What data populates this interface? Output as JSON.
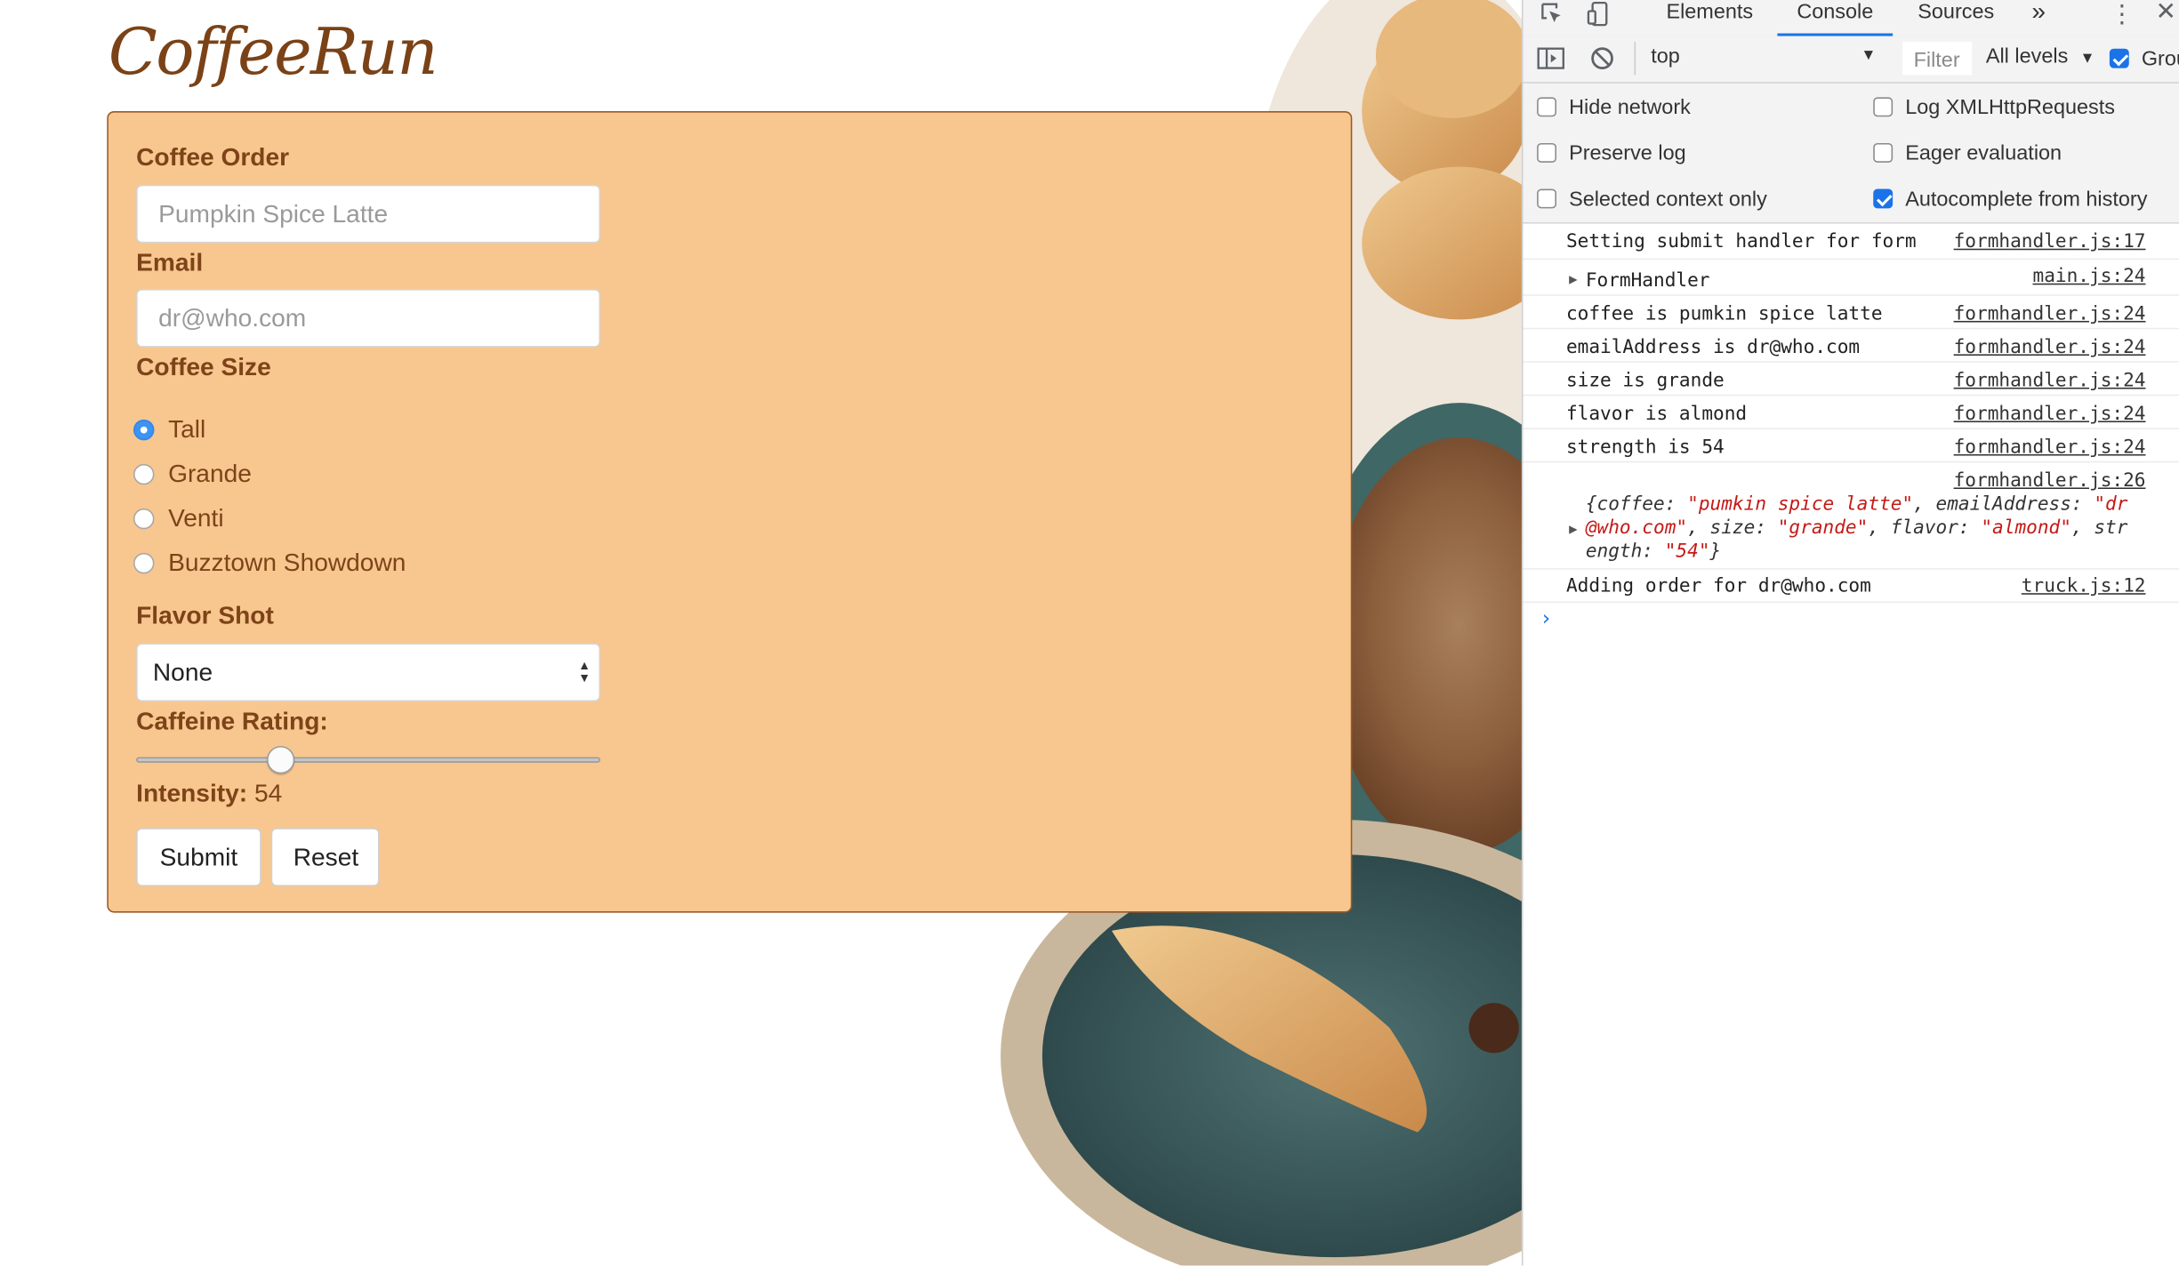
{
  "app": {
    "title": "CoffeeRun"
  },
  "form": {
    "coffee_label": "Coffee Order",
    "coffee_placeholder": "Pumpkin Spice Latte",
    "email_label": "Email",
    "email_placeholder": "dr@who.com",
    "size_label": "Coffee Size",
    "sizes": [
      {
        "label": "Tall",
        "checked": true
      },
      {
        "label": "Grande",
        "checked": false
      },
      {
        "label": "Venti",
        "checked": false
      },
      {
        "label": "Buzztown Showdown",
        "checked": false
      }
    ],
    "flavor_label": "Flavor Shot",
    "flavor_value": "None",
    "caffeine_label": "Caffeine Rating:",
    "slider_value": 30,
    "intensity_label": "Intensity:",
    "intensity_value": "54",
    "submit_label": "Submit",
    "reset_label": "Reset"
  },
  "devtools": {
    "tabs": [
      "Elements",
      "Console",
      "Sources",
      "»"
    ],
    "active_tab": "Console",
    "context": "top",
    "filter_placeholder": "Filter",
    "levels": "All levels",
    "group_label": "Grou",
    "settings": [
      {
        "label": "Hide network",
        "checked": false
      },
      {
        "label": "Log XMLHttpRequests",
        "checked": false
      },
      {
        "label": "Preserve log",
        "checked": false
      },
      {
        "label": "Eager evaluation",
        "checked": false
      },
      {
        "label": "Selected context only",
        "checked": false
      },
      {
        "label": "Autocomplete from history",
        "checked": true
      }
    ],
    "logs": [
      {
        "msg": "Setting submit handler for form",
        "src": "formhandler.js:17"
      },
      {
        "msg": "FormHandler",
        "src": "main.js:24",
        "expandable": true
      },
      {
        "msg": "coffee is pumkin spice latte",
        "src": "formhandler.js:24"
      },
      {
        "msg": "emailAddress is dr@who.com",
        "src": "formhandler.js:24"
      },
      {
        "msg": "size is grande",
        "src": "formhandler.js:24"
      },
      {
        "msg": "flavor is almond",
        "src": "formhandler.js:24"
      },
      {
        "msg": "strength is 54",
        "src": "formhandler.js:24"
      },
      {
        "msg": "",
        "src": "formhandler.js:26"
      },
      {
        "msg": "Adding order for dr@who.com",
        "src": "truck.js:12"
      }
    ],
    "object_log": {
      "line1_a": "{coffee: ",
      "line1_b": "\"pumkin spice latte\"",
      "line1_c": ", emailAddress: ",
      "line1_d": "\"dr",
      "line2_a": "@who.com\"",
      "line2_b": ", size: ",
      "line2_c": "\"grande\"",
      "line2_d": ", flavor: ",
      "line2_e": "\"almond\"",
      "line2_f": ", str",
      "line3_a": "ength: ",
      "line3_b": "\"54\"",
      "line3_c": "}"
    },
    "prompt": "›"
  }
}
